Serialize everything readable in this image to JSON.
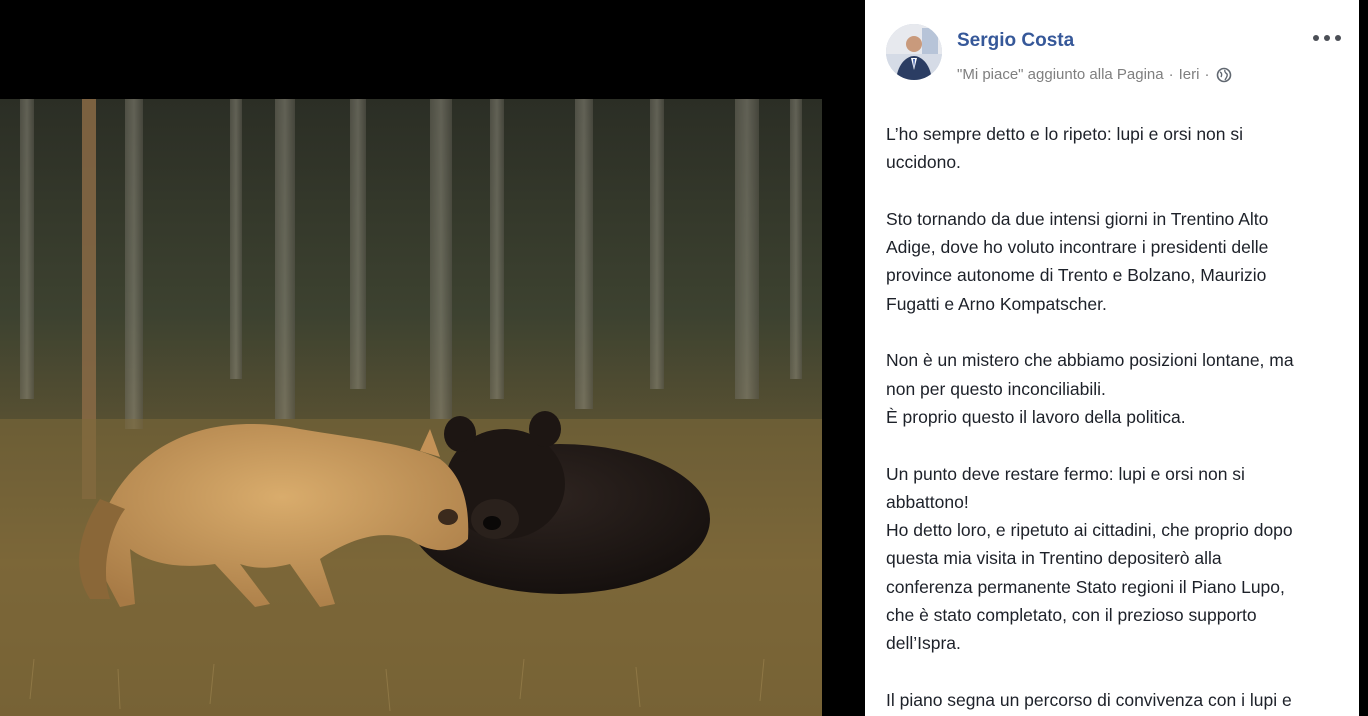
{
  "post": {
    "author": "Sergio Costa",
    "meta": {
      "action": "\"Mi piace\" aggiunto alla Pagina",
      "separator": "·",
      "time": "Ieri",
      "separator2": "·"
    },
    "body": {
      "p1": [
        "L’ho sempre detto e lo ripeto: lupi e orsi non si",
        "uccidono."
      ],
      "p2": [
        "Sto tornando da due intensi giorni in Trentino Alto",
        "Adige, dove ho voluto incontrare i presidenti delle",
        "province autonome di Trento e Bolzano, Maurizio",
        "Fugatti e Arno Kompatscher."
      ],
      "p3": [
        "Non è un mistero che abbiamo posizioni lontane, ma",
        "non per questo inconciliabili.",
        "È proprio questo il lavoro della politica."
      ],
      "p4": [
        "Un punto deve restare fermo: lupi e orsi non si",
        "abbattono!",
        "Ho detto loro, e ripetuto ai cittadini, che proprio dopo",
        "questa mia visita in Trentino depositerò alla",
        "conferenza permanente Stato regioni il Piano Lupo,",
        "che è stato completato, con il prezioso supporto",
        "dell’Ispra."
      ],
      "p5": [
        "Il piano segna un percorso di convivenza con i lupi e"
      ]
    }
  },
  "icons": {
    "more": "more-horizontal-icon",
    "privacy": "globe-icon"
  },
  "colors": {
    "author_link": "#365899",
    "meta_text": "#7f7f7f",
    "body_text": "#1d2129",
    "background": "#000000"
  }
}
